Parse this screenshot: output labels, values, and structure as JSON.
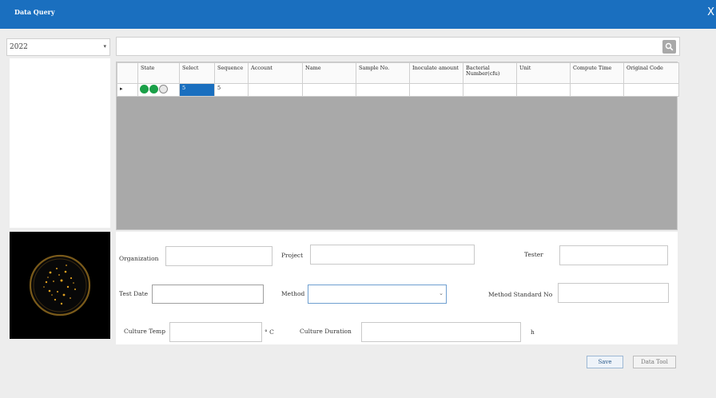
{
  "window": {
    "title": "Data Query",
    "close_glyph": "X"
  },
  "filter": {
    "year_value": "2022",
    "year_arrow": "▾",
    "search_value": "",
    "search_icon": "magnifier-icon"
  },
  "grid": {
    "columns": [
      "",
      "State",
      "Select",
      "Sequence",
      "Account",
      "Name",
      "Sample No.",
      "Inoculate amount",
      "Bacterial Number(cfu)",
      "Unit",
      "Compute Time",
      "Original Code"
    ],
    "rows": [
      {
        "indicator": "▸",
        "state": [
          "green",
          "green",
          "empty"
        ],
        "select": "5",
        "sequence": "5",
        "account": "",
        "name": "",
        "sample_no": "",
        "inoculate": "",
        "bacterial": "",
        "unit": "",
        "compute_time": "",
        "original_code": ""
      }
    ]
  },
  "form": {
    "organization_label": "Organization",
    "organization_value": "",
    "project_label": "Project",
    "project_value": "",
    "tester_label": "Tester",
    "tester_value": "",
    "test_date_label": "Test Date",
    "test_date_value": "",
    "method_label": "Method",
    "method_value": "",
    "method_standard_label": "Method Standard No",
    "method_standard_value": "",
    "culture_temp_label": "Culture Temp",
    "culture_temp_value": "",
    "culture_temp_unit": "° C",
    "culture_duration_label": "Culture Duration",
    "culture_duration_value": "",
    "culture_duration_unit": "h"
  },
  "buttons": {
    "save": "Save",
    "data_tool": "Data Tool"
  },
  "colors": {
    "titlebar": "#1a6fbf",
    "state_green": "#1aa048",
    "grid_empty": "#a9a9a9",
    "colony": "#e0a020"
  }
}
